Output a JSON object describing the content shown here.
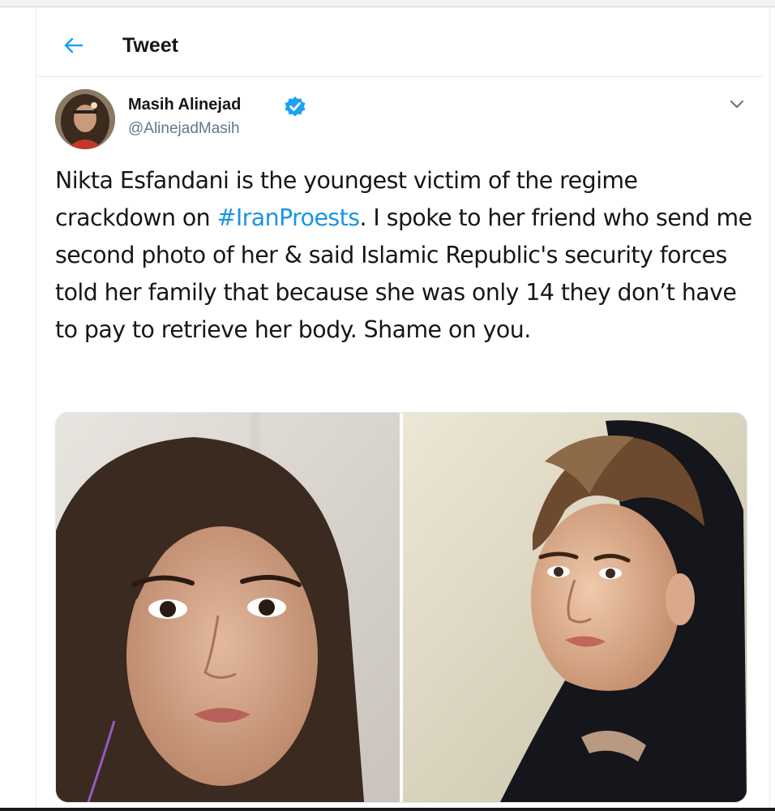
{
  "header": {
    "title": "Tweet",
    "back_icon": "arrow-left-icon"
  },
  "tweet": {
    "author": {
      "name": "Masih Alinejad",
      "handle": "@AlinejadMasih",
      "verified": true,
      "verified_icon": "verified-badge-icon"
    },
    "text": {
      "part1": "Nikta Esfandani is the youngest victim of the regime crackdown on ",
      "hashtag": "#IranProests",
      "part2": ". I spoke to her friend who send me second photo of her & said Islamic Republic's security forces told her family that because she was only 14 they don’t have to pay to retrieve her body. Shame on you."
    },
    "menu_icon": "chevron-down-icon",
    "media": [
      {
        "kind": "photo",
        "icon": "photo-portrait-1"
      },
      {
        "kind": "photo",
        "icon": "photo-portrait-2"
      }
    ]
  },
  "colors": {
    "accent": "#1da1f2",
    "hashtag": "#1b95e0",
    "text": "#14171a",
    "secondary_text": "#657786",
    "border": "#e6ecf0"
  }
}
